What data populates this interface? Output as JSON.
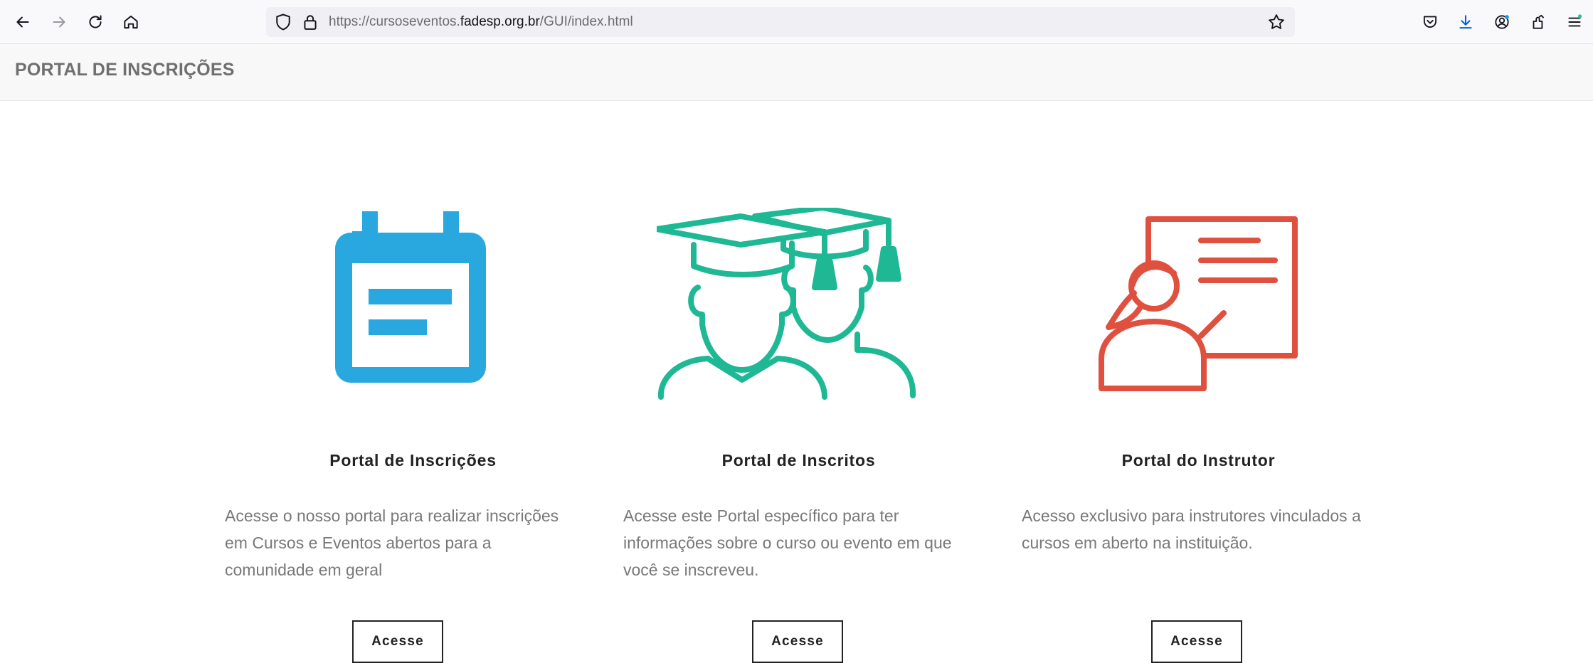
{
  "browser": {
    "url_prefix": "https://cursoseventos.",
    "url_host": "fadesp.org.br",
    "url_suffix": "/GUI/index.html",
    "icons": [
      "back-icon",
      "forward-icon",
      "reload-icon",
      "home-icon",
      "shield-icon",
      "lock-icon",
      "star-icon",
      "pocket-icon",
      "download-icon",
      "account-icon",
      "extensions-icon",
      "menu-icon"
    ]
  },
  "header": {
    "brand": "PORTAL DE INSCRIÇÕES"
  },
  "colors": {
    "calendar_blue": "#29a8e0",
    "graduates_green": "#1fb894",
    "instructor_red": "#e0503f"
  },
  "cards": [
    {
      "title": "Portal de Inscrições",
      "description": "Acesse o nosso portal para realizar inscrições em Cursos e Eventos abertos para a comunidade em geral",
      "button": "Acesse",
      "icon": "calendar-icon"
    },
    {
      "title": "Portal de Inscritos",
      "description": "Acesse este Portal específico para ter informações sobre o curso ou evento em que você se inscreveu.",
      "button": "Acesse",
      "icon": "graduates-icon"
    },
    {
      "title": "Portal do Instrutor",
      "description": "Acesso exclusivo para instrutores vinculados a cursos em aberto na instituição.",
      "button": "Acesse",
      "icon": "instructor-icon"
    }
  ]
}
